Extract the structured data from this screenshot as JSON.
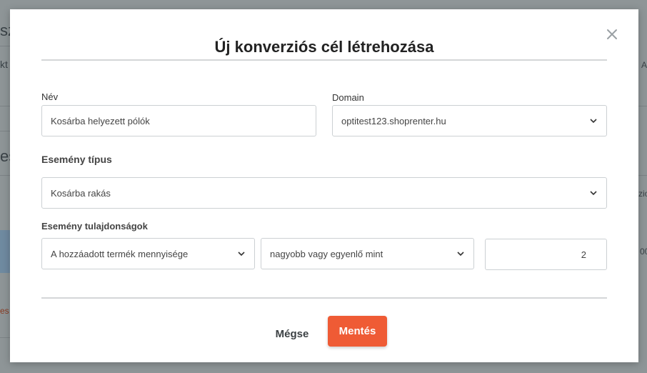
{
  "background": {
    "fragments": [
      "sz",
      "kt",
      "es",
      "A",
      "zio",
      "00",
      "es"
    ]
  },
  "modal": {
    "title": "Új konverziós cél létrehozása",
    "name_label": "Név",
    "name_value": "Kosárba helyezett pólók",
    "domain_label": "Domain",
    "domain_value": "optitest123.shoprenter.hu",
    "event_type_label": "Esemény típus",
    "event_type_value": "Kosárba rakás",
    "event_props_label": "Esemény tulajdonságok",
    "property_value": "A hozzáadott termék mennyisége",
    "operator_value": "nagyobb vagy egyenlő mint",
    "quantity_value": "2",
    "cancel_label": "Mégse",
    "save_label": "Mentés"
  },
  "colors": {
    "accent": "#ef5b35",
    "overlay": "#8e9597"
  },
  "icons": {
    "close": "close-icon",
    "dropdown": "chevron-down-icon"
  }
}
